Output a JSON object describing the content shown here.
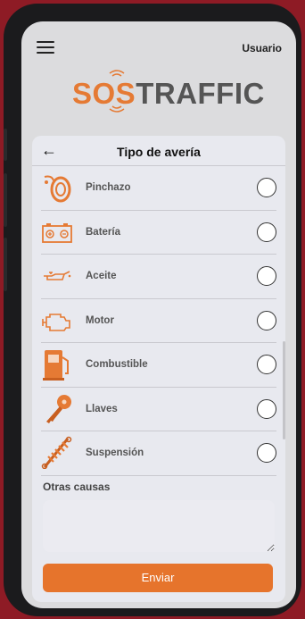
{
  "header": {
    "user_label": "Usuario"
  },
  "logo": {
    "part1": "SOS",
    "part2": "TRAFFIC"
  },
  "card": {
    "title": "Tipo de avería",
    "items": [
      {
        "label": "Pinchazo",
        "icon": "tire-icon"
      },
      {
        "label": "Batería",
        "icon": "battery-icon"
      },
      {
        "label": "Aceite",
        "icon": "oil-can-icon"
      },
      {
        "label": "Motor",
        "icon": "engine-icon"
      },
      {
        "label": "Combustible",
        "icon": "fuel-pump-icon"
      },
      {
        "label": "Llaves",
        "icon": "key-icon"
      },
      {
        "label": "Suspensión",
        "icon": "suspension-spring-icon"
      }
    ],
    "other_label": "Otras causas",
    "send_label": "Enviar"
  },
  "colors": {
    "accent": "#e6742c",
    "background": "#8e1b25"
  }
}
